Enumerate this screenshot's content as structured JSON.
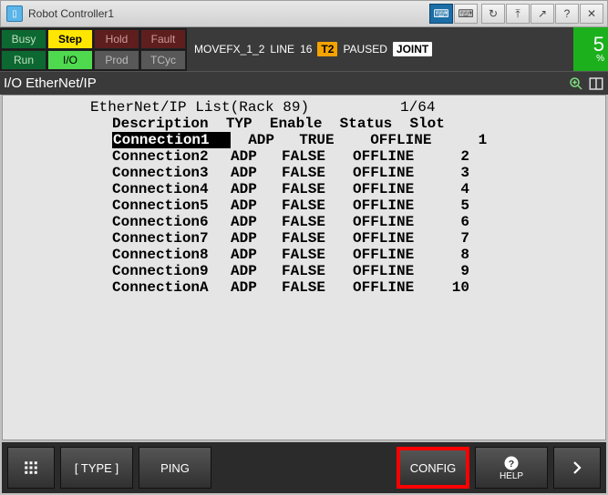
{
  "titlebar": {
    "title": "Robot Controller1"
  },
  "status": {
    "busy": "Busy",
    "step": "Step",
    "hold": "Hold",
    "fault": "Fault",
    "run": "Run",
    "io": "I/O",
    "prod": "Prod",
    "tcyc": "TCyc"
  },
  "message": {
    "program": "MOVEFX_1_2",
    "line_label": "LINE",
    "line_no": "16",
    "mode": "T2",
    "state": "PAUSED",
    "coord": "JOINT"
  },
  "speed": {
    "value": "5",
    "unit": "%"
  },
  "subheader": {
    "label": "I/O EtherNet/IP"
  },
  "list": {
    "title": "EtherNet/IP List(Rack 89)",
    "pager": "1/64",
    "columns": {
      "desc": "Description",
      "typ": "TYP",
      "en": "Enable",
      "stat": "Status",
      "slot": "Slot"
    },
    "rows": [
      {
        "desc": "Connection1",
        "typ": "ADP",
        "en": "TRUE",
        "stat": "OFFLINE",
        "slot": "1",
        "selected": true
      },
      {
        "desc": "Connection2",
        "typ": "ADP",
        "en": "FALSE",
        "stat": "OFFLINE",
        "slot": "2"
      },
      {
        "desc": "Connection3",
        "typ": "ADP",
        "en": "FALSE",
        "stat": "OFFLINE",
        "slot": "3"
      },
      {
        "desc": "Connection4",
        "typ": "ADP",
        "en": "FALSE",
        "stat": "OFFLINE",
        "slot": "4"
      },
      {
        "desc": "Connection5",
        "typ": "ADP",
        "en": "FALSE",
        "stat": "OFFLINE",
        "slot": "5"
      },
      {
        "desc": "Connection6",
        "typ": "ADP",
        "en": "FALSE",
        "stat": "OFFLINE",
        "slot": "6"
      },
      {
        "desc": "Connection7",
        "typ": "ADP",
        "en": "FALSE",
        "stat": "OFFLINE",
        "slot": "7"
      },
      {
        "desc": "Connection8",
        "typ": "ADP",
        "en": "FALSE",
        "stat": "OFFLINE",
        "slot": "8"
      },
      {
        "desc": "Connection9",
        "typ": "ADP",
        "en": "FALSE",
        "stat": "OFFLINE",
        "slot": "9"
      },
      {
        "desc": "ConnectionA",
        "typ": "ADP",
        "en": "FALSE",
        "stat": "OFFLINE",
        "slot": "10"
      }
    ]
  },
  "bottom": {
    "type": "[ TYPE ]",
    "ping": "PING",
    "config": "CONFIG",
    "help": "HELP"
  }
}
